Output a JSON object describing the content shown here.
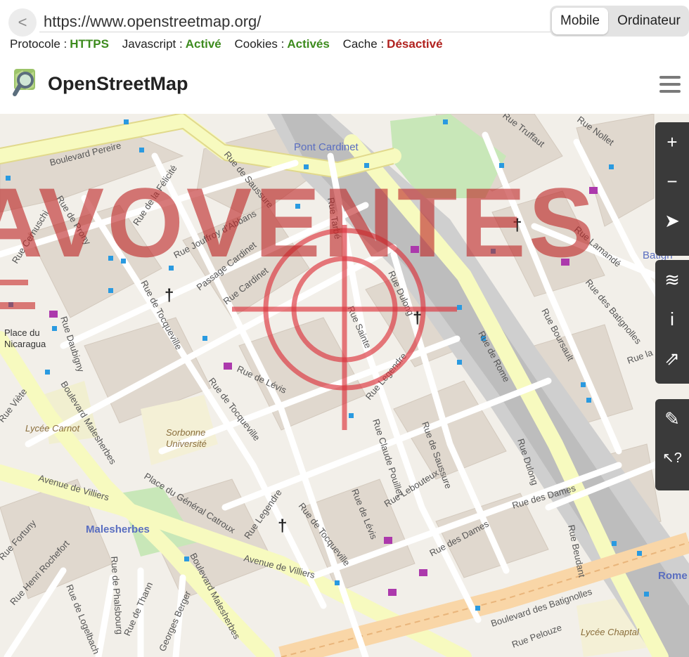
{
  "browser": {
    "back_label": "<",
    "url": "https://www.openstreetmap.org/",
    "mode_mobile": "Mobile",
    "mode_desktop": "Ordinateur"
  },
  "status": {
    "protocol_label": "Protocole :",
    "protocol_value": "HTTPS",
    "javascript_label": "Javascript :",
    "javascript_value": "Activé",
    "cookies_label": "Cookies :",
    "cookies_value": "Activés",
    "cache_label": "Cache :",
    "cache_value": "Désactivé",
    "colors": {
      "ok": "#3d8b1e",
      "off": "#b0211e"
    }
  },
  "header": {
    "site_name": "OpenStreetMap",
    "logo_icon": "magnifier-map-logo",
    "menu_icon": "hamburger-menu-icon"
  },
  "watermark": {
    "text": "AVOVENTES"
  },
  "map": {
    "labels": {
      "boulevard_pereire": "Boulevard Pereire",
      "pont_cardinet": "Pont Cardinet",
      "place_nicaragua_1": "Place du",
      "place_nicaragua_2": "Nicaragua",
      "rue_cernuschi": "Rue Cernuschi",
      "rue_jouffroy": "Rue Jouffroy d'Abbans",
      "passage_cardinet": "Passage Cardinet",
      "rue_cardinet": "Rue Cardinet",
      "rue_tarbe": "Rue Tarbé",
      "rue_de_saussure": "Rue de Saussure",
      "rue_saussure_2": "Rue de Saussure",
      "rue_dulong": "Rue Dulong",
      "rue_legendre": "Rue Legendre",
      "rue_legendre_2": "Rue Legendre",
      "rue_de_rome": "Rue de Rome",
      "rue_de_levis": "Rue de Lévis",
      "rue_de_levis_2": "Rue de Lévis",
      "rue_tocqueville": "Rue de Tocqueville",
      "rue_tocqueville_2": "Rue de Tocqueville",
      "rue_tocqueville_3": "Rue de Tocqueville",
      "rue_claude_pouillet": "Rue Claude Pouillet",
      "rue_lebouteux": "Rue Lebouteux",
      "rue_des_dames": "Rue des Dames",
      "rue_des_dames_2": "Rue des Dames",
      "rue_dulong_2": "Rue Dulong",
      "rue_boursault": "Rue Boursault",
      "rue_des_batignolles": "Rue des Batignolles",
      "rue_lamande": "Rue Lamandé",
      "rue_truffaut": "Rue Truffaut",
      "rue_nollet": "Rue Nollet",
      "boulevard_malesherbes": "Boulevard Malesherbes",
      "boulevard_malesherbes_2": "Boulevard Malesherbes",
      "lycee_carnot": "Lycée Carnot",
      "sorbonne_1": "Sorbonne",
      "sorbonne_2": "Université",
      "place_catroux": "Place du Général Catroux",
      "avenue_villiers": "Avenue de Villiers",
      "avenue_villiers_2": "Avenue de Villiers",
      "malesherbes_station": "Malesherbes",
      "rue_fortuny": "Rue Fortuny",
      "rue_henri_rochefort": "Rue Henri Rochefort",
      "rue_de_logelbach": "Rue de Logelbach",
      "rue_phalsbourg": "Rue de Phalsbourg",
      "rue_de_thann": "Rue de Thann",
      "georges_berger": "Georges Berger",
      "boulevard_batignolles": "Boulevard des Batignolles",
      "lycee_chaptal": "Lycée Chaptal",
      "rue_viete": "Rue Viète",
      "rue_daubigny": "Rue Daubigny",
      "rue_felicite": "Rue de la Félicité",
      "rue_prony": "Rue de Prony",
      "rue_peloure": "Rue Pelouze",
      "rue_beudant": "Rue Beudant",
      "rue_la": "Rue la",
      "rome_label": "Rome",
      "batign_label": "Batign",
      "rue_saint": "Rue Sainte"
    }
  },
  "controls": {
    "zoom_in": "+",
    "zoom_out": "−",
    "locate": "➤",
    "layers": "≋",
    "info": "i",
    "share": "⇗",
    "note": "✎",
    "query": "↖?"
  }
}
